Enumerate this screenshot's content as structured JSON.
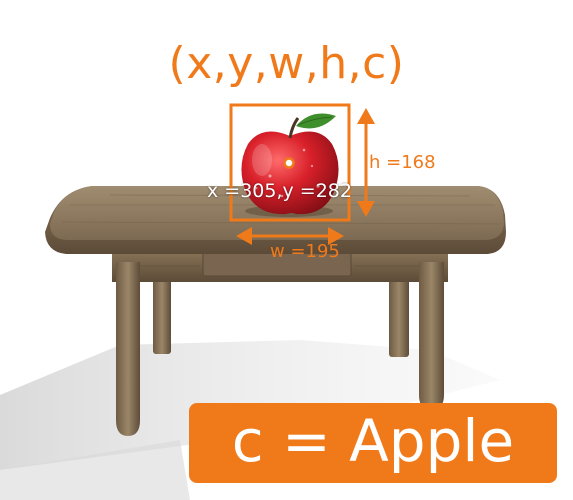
{
  "title": "(x,y,w,h,c)",
  "coords_label": "x =305,y =282",
  "height_label": "h =168",
  "width_label": "w =195",
  "class_label": "c = Apple",
  "colors": {
    "accent": "#f07a1a",
    "label_text": "#ffffff",
    "background": "#ffffff"
  },
  "scene": {
    "objects": [
      "wooden-table",
      "red-apple"
    ]
  }
}
